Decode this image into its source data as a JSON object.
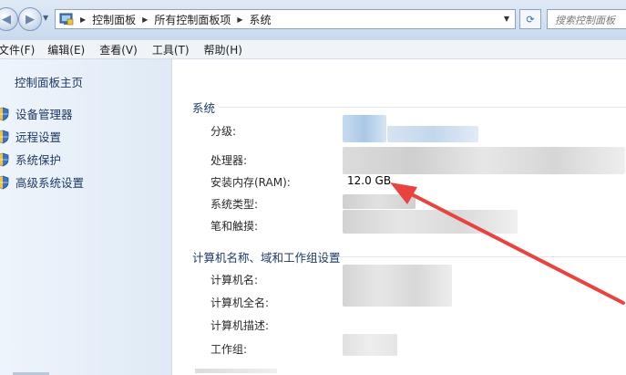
{
  "address_bar": {
    "breadcrumbs": [
      "控制面板",
      "所有控制面板项",
      "系统"
    ],
    "search_placeholder": "搜索控制面板"
  },
  "menu": [
    "文件(F)",
    "编辑(E)",
    "查看(V)",
    "工具(T)",
    "帮助(H)"
  ],
  "sidebar": {
    "home": "控制面板主页",
    "tasks": [
      "设备管理器",
      "远程设置",
      "系统保护",
      "高级系统设置"
    ]
  },
  "system_section": {
    "title": "系统",
    "rows": [
      {
        "label": "分级:",
        "value": ""
      },
      {
        "label": "处理器:",
        "value": ""
      },
      {
        "label": "安装内存(RAM):",
        "value": "12.0 GB"
      },
      {
        "label": "系统类型:",
        "value": ""
      },
      {
        "label": "笔和触摸:",
        "value": ""
      }
    ]
  },
  "computer_section": {
    "title": "计算机名称、域和工作组设置",
    "rows": [
      {
        "label": "计算机名:",
        "value": ""
      },
      {
        "label": "计算机全名:",
        "value": ""
      },
      {
        "label": "计算机描述:",
        "value": ""
      },
      {
        "label": "工作组:",
        "value": ""
      }
    ]
  },
  "colors": {
    "link": "#1e3a66",
    "annotation_arrow": "#e8433f",
    "sidebar_bg": "#e6eff9"
  },
  "icons": [
    "back-arrow-icon",
    "forward-arrow-icon",
    "control-panel-icon",
    "refresh-icon",
    "shield-icon"
  ]
}
